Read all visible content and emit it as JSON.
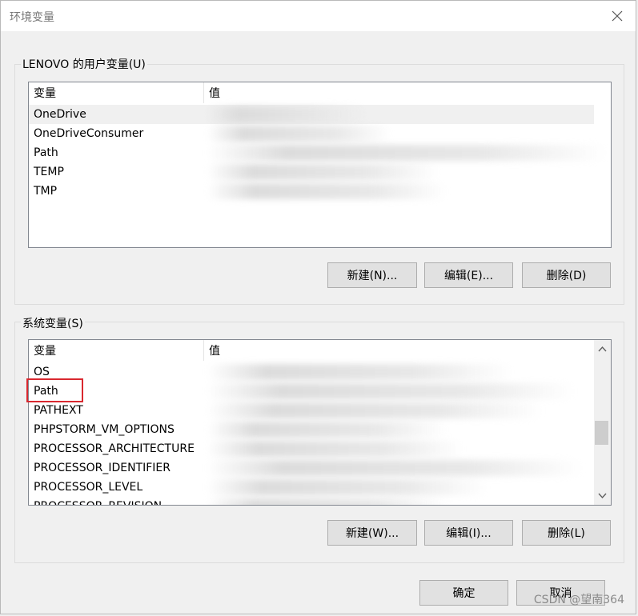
{
  "window": {
    "title": "环境变量"
  },
  "user_group": {
    "label": "LENOVO 的用户变量(U)",
    "columns": [
      "变量",
      "值"
    ],
    "rows": [
      {
        "name": "OneDrive",
        "selected": true
      },
      {
        "name": "OneDriveConsumer",
        "selected": false
      },
      {
        "name": "Path",
        "selected": false
      },
      {
        "name": "TEMP",
        "selected": false
      },
      {
        "name": "TMP",
        "selected": false
      }
    ],
    "buttons": {
      "new": "新建(N)...",
      "edit": "编辑(E)...",
      "delete": "删除(D)"
    }
  },
  "system_group": {
    "label": "系统变量(S)",
    "columns": [
      "变量",
      "值"
    ],
    "rows": [
      {
        "name": "OS"
      },
      {
        "name": "Path"
      },
      {
        "name": "PATHEXT"
      },
      {
        "name": "PHPSTORM_VM_OPTIONS"
      },
      {
        "name": "PROCESSOR_ARCHITECTURE"
      },
      {
        "name": "PROCESSOR_IDENTIFIER"
      },
      {
        "name": "PROCESSOR_LEVEL"
      },
      {
        "name": "PROCESSOR_REVISION"
      }
    ],
    "buttons": {
      "new": "新建(W)...",
      "edit": "编辑(I)...",
      "delete": "删除(L)"
    }
  },
  "footer": {
    "ok": "确定",
    "cancel": "取消"
  },
  "watermark": "CSDN @望南364",
  "colors": {
    "highlight": "#d9282f",
    "selected_row": "#f0f0f0"
  }
}
